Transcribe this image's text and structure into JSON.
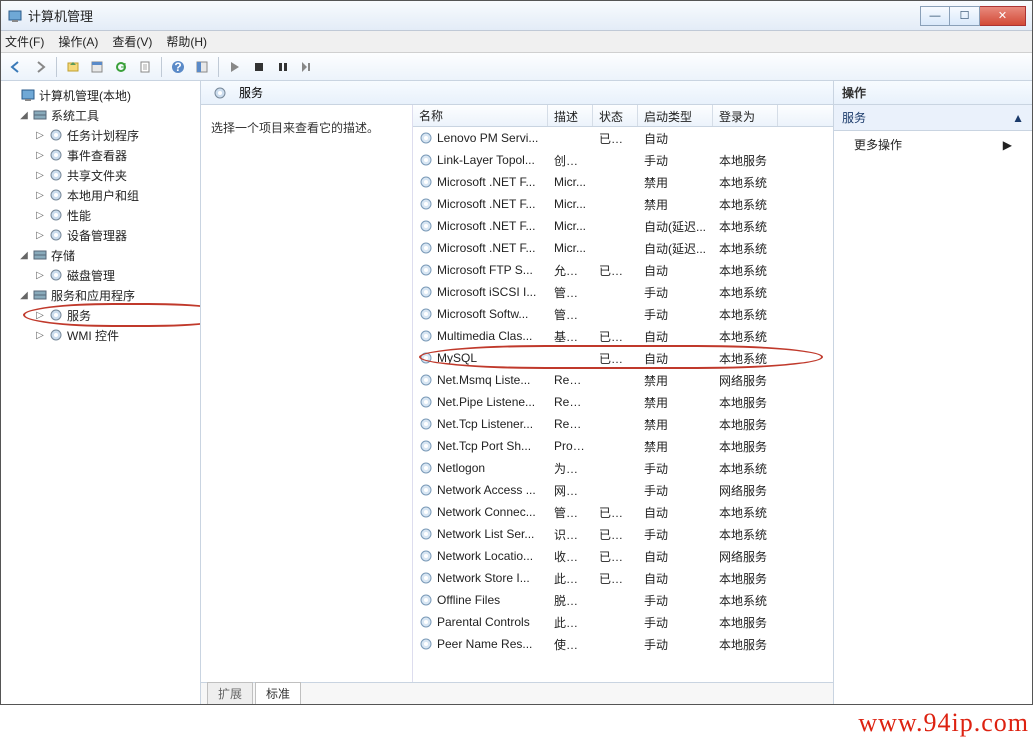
{
  "window": {
    "title": "计算机管理"
  },
  "menus": [
    "文件(F)",
    "操作(A)",
    "查看(V)",
    "帮助(H)"
  ],
  "tree": {
    "root": "计算机管理(本地)",
    "groups": [
      {
        "label": "系统工具",
        "expanded": true,
        "children": [
          {
            "label": "任务计划程序"
          },
          {
            "label": "事件查看器"
          },
          {
            "label": "共享文件夹"
          },
          {
            "label": "本地用户和组"
          },
          {
            "label": "性能"
          },
          {
            "label": "设备管理器"
          }
        ]
      },
      {
        "label": "存储",
        "expanded": true,
        "children": [
          {
            "label": "磁盘管理"
          }
        ]
      },
      {
        "label": "服务和应用程序",
        "expanded": true,
        "children": [
          {
            "label": "服务",
            "highlight": true
          },
          {
            "label": "WMI 控件"
          }
        ]
      }
    ]
  },
  "services_header": {
    "title": "服务"
  },
  "desc_hint": "选择一个项目来查看它的描述。",
  "columns": [
    "名称",
    "描述",
    "状态",
    "启动类型",
    "登录为"
  ],
  "rows": [
    {
      "name": "Lenovo PM Servi...",
      "desc": "",
      "status": "已启动",
      "startup": "自动",
      "logon": ""
    },
    {
      "name": "Link-Layer Topol...",
      "desc": "创建...",
      "status": "",
      "startup": "手动",
      "logon": "本地服务"
    },
    {
      "name": "Microsoft .NET F...",
      "desc": "Micr...",
      "status": "",
      "startup": "禁用",
      "logon": "本地系统"
    },
    {
      "name": "Microsoft .NET F...",
      "desc": "Micr...",
      "status": "",
      "startup": "禁用",
      "logon": "本地系统"
    },
    {
      "name": "Microsoft .NET F...",
      "desc": "Micr...",
      "status": "",
      "startup": "自动(延迟...",
      "logon": "本地系统"
    },
    {
      "name": "Microsoft .NET F...",
      "desc": "Micr...",
      "status": "",
      "startup": "自动(延迟...",
      "logon": "本地系统"
    },
    {
      "name": "Microsoft FTP S...",
      "desc": "允许...",
      "status": "已启动",
      "startup": "自动",
      "logon": "本地系统"
    },
    {
      "name": "Microsoft iSCSI I...",
      "desc": "管理...",
      "status": "",
      "startup": "手动",
      "logon": "本地系统"
    },
    {
      "name": "Microsoft Softw...",
      "desc": "管理...",
      "status": "",
      "startup": "手动",
      "logon": "本地系统"
    },
    {
      "name": "Multimedia Clas...",
      "desc": "基于...",
      "status": "已启动",
      "startup": "自动",
      "logon": "本地系统"
    },
    {
      "name": "MySQL",
      "desc": "",
      "status": "已启动",
      "startup": "自动",
      "logon": "本地系统",
      "highlight": true
    },
    {
      "name": "Net.Msmq Liste...",
      "desc": "Rece...",
      "status": "",
      "startup": "禁用",
      "logon": "网络服务"
    },
    {
      "name": "Net.Pipe Listene...",
      "desc": "Rece...",
      "status": "",
      "startup": "禁用",
      "logon": "本地服务"
    },
    {
      "name": "Net.Tcp Listener...",
      "desc": "Rece...",
      "status": "",
      "startup": "禁用",
      "logon": "本地服务"
    },
    {
      "name": "Net.Tcp Port Sh...",
      "desc": "Prov...",
      "status": "",
      "startup": "禁用",
      "logon": "本地服务"
    },
    {
      "name": "Netlogon",
      "desc": "为用...",
      "status": "",
      "startup": "手动",
      "logon": "本地系统"
    },
    {
      "name": "Network Access ...",
      "desc": "网络...",
      "status": "",
      "startup": "手动",
      "logon": "网络服务"
    },
    {
      "name": "Network Connec...",
      "desc": "管理...",
      "status": "已启动",
      "startup": "自动",
      "logon": "本地系统"
    },
    {
      "name": "Network List Ser...",
      "desc": "识别...",
      "status": "已启动",
      "startup": "手动",
      "logon": "本地系统"
    },
    {
      "name": "Network Locatio...",
      "desc": "收集...",
      "status": "已启动",
      "startup": "自动",
      "logon": "网络服务"
    },
    {
      "name": "Network Store I...",
      "desc": "此服...",
      "status": "已启动",
      "startup": "自动",
      "logon": "本地服务"
    },
    {
      "name": "Offline Files",
      "desc": "脱机...",
      "status": "",
      "startup": "手动",
      "logon": "本地系统"
    },
    {
      "name": "Parental Controls",
      "desc": "此服...",
      "status": "",
      "startup": "手动",
      "logon": "本地服务"
    },
    {
      "name": "Peer Name Res...",
      "desc": "使用...",
      "status": "",
      "startup": "手动",
      "logon": "本地服务"
    }
  ],
  "bottom_tabs": [
    "扩展",
    "标准"
  ],
  "actions": {
    "header": "操作",
    "section": "服务",
    "more": "更多操作"
  },
  "watermark": "www.94ip.com"
}
